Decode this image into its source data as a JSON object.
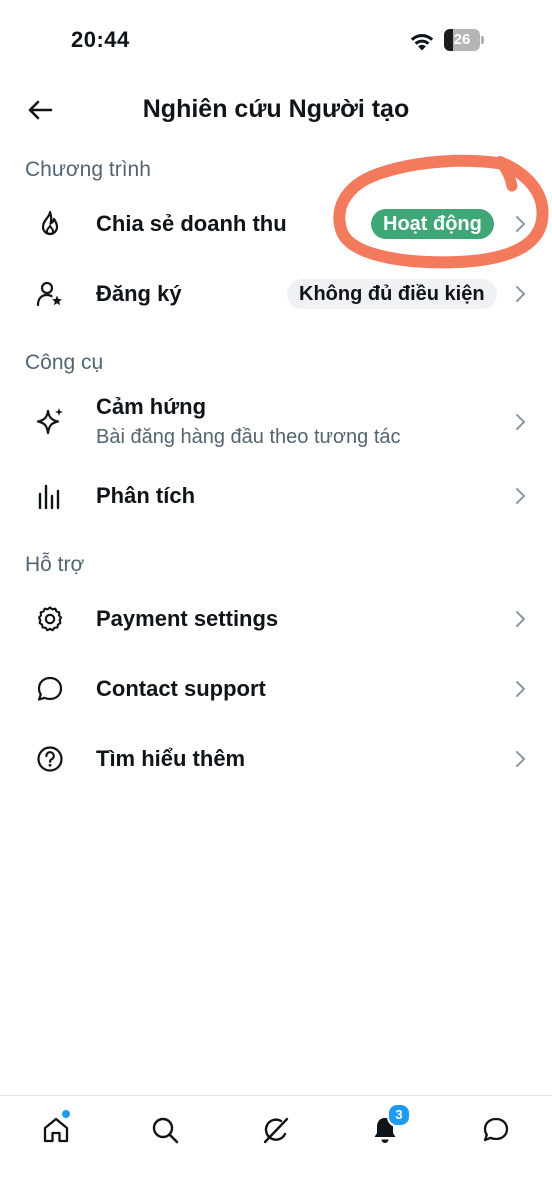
{
  "status_bar": {
    "time": "20:44",
    "battery_level": "26",
    "battery_fraction": 0.26
  },
  "header": {
    "title": "Nghiên cứu Người tạo"
  },
  "sections": {
    "program": {
      "title": "Chương trình",
      "items": [
        {
          "label": "Chia sẻ doanh thu",
          "badge": "Hoạt động",
          "icon": "flame-icon"
        },
        {
          "label": "Đăng ký",
          "badge": "Không đủ điều kiện",
          "icon": "person-star-icon"
        }
      ]
    },
    "tools": {
      "title": "Công cụ",
      "items": [
        {
          "label": "Cảm hứng",
          "subtitle": "Bài đăng hàng đầu theo tương tác",
          "icon": "sparkle-icon"
        },
        {
          "label": "Phân tích",
          "icon": "bar-chart-icon"
        }
      ]
    },
    "support": {
      "title": "Hỗ trợ",
      "items": [
        {
          "label": "Payment settings",
          "icon": "gear-icon"
        },
        {
          "label": "Contact support",
          "icon": "chat-bubble-icon"
        },
        {
          "label": "Tìm hiểu thêm",
          "icon": "question-circle-icon"
        }
      ]
    }
  },
  "bottom_nav": {
    "notifications_count": "3",
    "items": [
      "home-icon",
      "search-icon",
      "grok-icon",
      "bell-icon",
      "messages-icon"
    ]
  },
  "colors": {
    "active_badge": "#3fa776",
    "annotation": "#f47a5e",
    "accent": "#1d9bf0"
  }
}
